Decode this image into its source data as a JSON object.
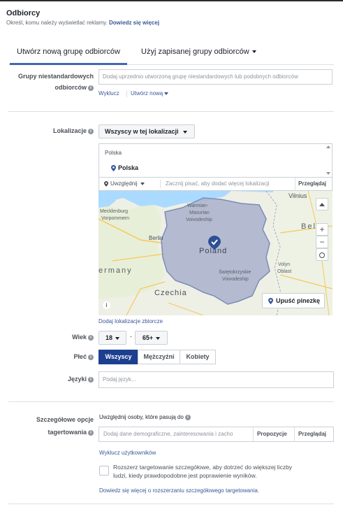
{
  "header": {
    "title": "Odbiorcy",
    "subtitle": "Określ, komu należy wyświetlać reklamy.",
    "learn_more": "Dowiedz się więcej"
  },
  "tabs": [
    {
      "label": "Utwórz nową grupę odbiorców"
    },
    {
      "label": "Użyj zapisanej grupy odbiorców"
    }
  ],
  "custom_audiences": {
    "label_line1": "Grupy niestandardowych",
    "label_line2": "odbiorców",
    "placeholder": "Dodaj uprzednio utworzoną grupę niestandardowych lub podobnych odbiorców",
    "exclude": "Wyklucz",
    "create_new": "Utwórz nową"
  },
  "location": {
    "label": "Lokalizacje",
    "dropdown": "Wszyscy w tej lokalizacji",
    "country_header": "Polska",
    "selected": "Polska",
    "include": "Uwzględnij",
    "search_placeholder": "Zacznij pisać, aby dodać więcej lokalizacji",
    "browse": "Przeglądaj",
    "bulk_link": "Dodaj lokalizacje zbiorcze",
    "drop_pin": "Upuść pinezkę",
    "map_labels": {
      "vilnius": "Vilnius",
      "warmian": "Warmian-",
      "masurian": "Masurian",
      "voivodeship1": "Voivodeship",
      "mecklenburg": "Mecklenburg",
      "vorpommern": "Vorpommern",
      "berlin": "Berlin",
      "poland": "Poland",
      "bel": "Bel",
      "ermany": "ermany",
      "swietokrzyskie": "Świętokrzyskie",
      "voivodeship2": "Voivodeship",
      "volyn": "Volyn",
      "oblast": "Oblast",
      "czechia": "Czechia"
    }
  },
  "age": {
    "label": "Wiek",
    "min": "18",
    "separator": "-",
    "max": "65+"
  },
  "gender": {
    "label": "Płeć",
    "options": [
      "Wszyscy",
      "Mężczyźni",
      "Kobiety"
    ],
    "selected": "Wszyscy"
  },
  "languages": {
    "label": "Języki",
    "placeholder": "Podaj język..."
  },
  "detailed_targeting": {
    "label_line1": "Szczegółowe opcje",
    "label_line2": "tagertowania",
    "include_text": "Uwzględnij osoby, które pasują do",
    "placeholder": "Dodaj dane demograficzne, zainteresowania i zacho",
    "suggestions": "Propozycje",
    "browse": "Przeglądaj",
    "exclude_users": "Wyklucz użytkowników",
    "expand_text_line1": "Rozszerz targetowanie szczegółowe, aby dotrzeć do większej liczby",
    "expand_text_line2": "ludzi, kiedy prawdopodobne jest poprawienie wyników.",
    "expand_checked": false,
    "learn_more_expand": "Dowiedz się więcej o rozszerzaniu szczegółowego targetowania."
  },
  "colors": {
    "link": "#385898",
    "tab_active": "#4267b2",
    "selected_segment": "#1c3f8f"
  }
}
